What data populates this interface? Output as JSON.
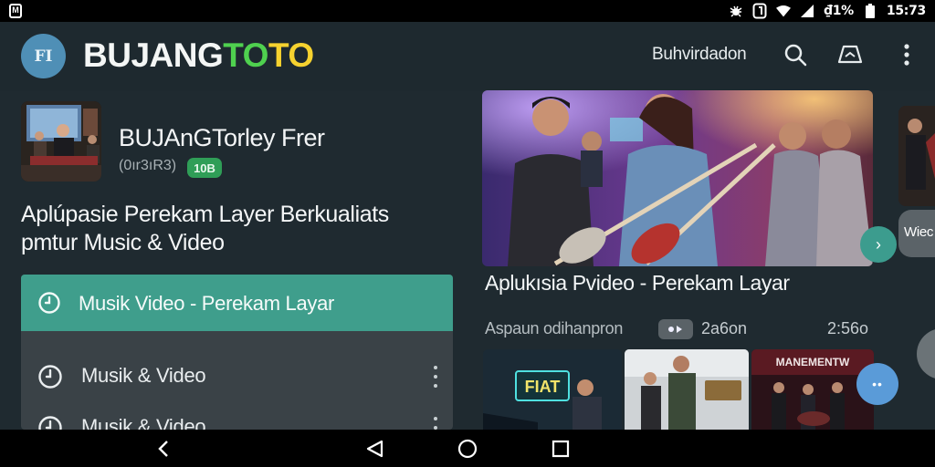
{
  "status_bar": {
    "battery_text": "₫1%",
    "time": "15:73",
    "icons": [
      "notification-box-icon",
      "bug-icon",
      "carrier-icon",
      "wifi-icon",
      "cell-signal-icon",
      "battery-icon"
    ]
  },
  "app_bar": {
    "logo_glyph": "FI",
    "brand": {
      "part1": "BUJANG",
      "part2": "TO",
      "part3": "TO"
    },
    "link_label": "Buhvirdadon",
    "icons": [
      "search-icon",
      "cast-icon",
      "more-vert-icon"
    ]
  },
  "app_info": {
    "title": "BUJAnGTorley   Frer",
    "subtitle": "(0ır3ıR3)",
    "badge": "10B"
  },
  "headline": {
    "line1": "Aplúpasie Perekam Layer Berkualiats",
    "line2": "pmtur Music & Video"
  },
  "menu": {
    "active_label": "Musik Video - Perekam Layar",
    "items": [
      {
        "label": "Musik & Video"
      },
      {
        "label": "Musik & Video"
      }
    ]
  },
  "featured": {
    "caption": "Aplukısia Pvideo - Perekam Layar",
    "meta_text": "Aspaun odihanpron",
    "meta_badge_label": "2a6on",
    "duration": "2:56o",
    "thumb_sign": "FIAT",
    "thumb3_title": "MANEMENTW"
  },
  "side_peek": {
    "pill_text": "Wiec"
  },
  "fab": {
    "label": "••"
  },
  "colors": {
    "background": "#1f2a30",
    "accent_teal": "#3f9e8c",
    "brand_green": "#4fd14f",
    "brand_yellow": "#f6d22f",
    "badge_green": "#2f9e57",
    "fab_blue": "#5a9bd8"
  }
}
